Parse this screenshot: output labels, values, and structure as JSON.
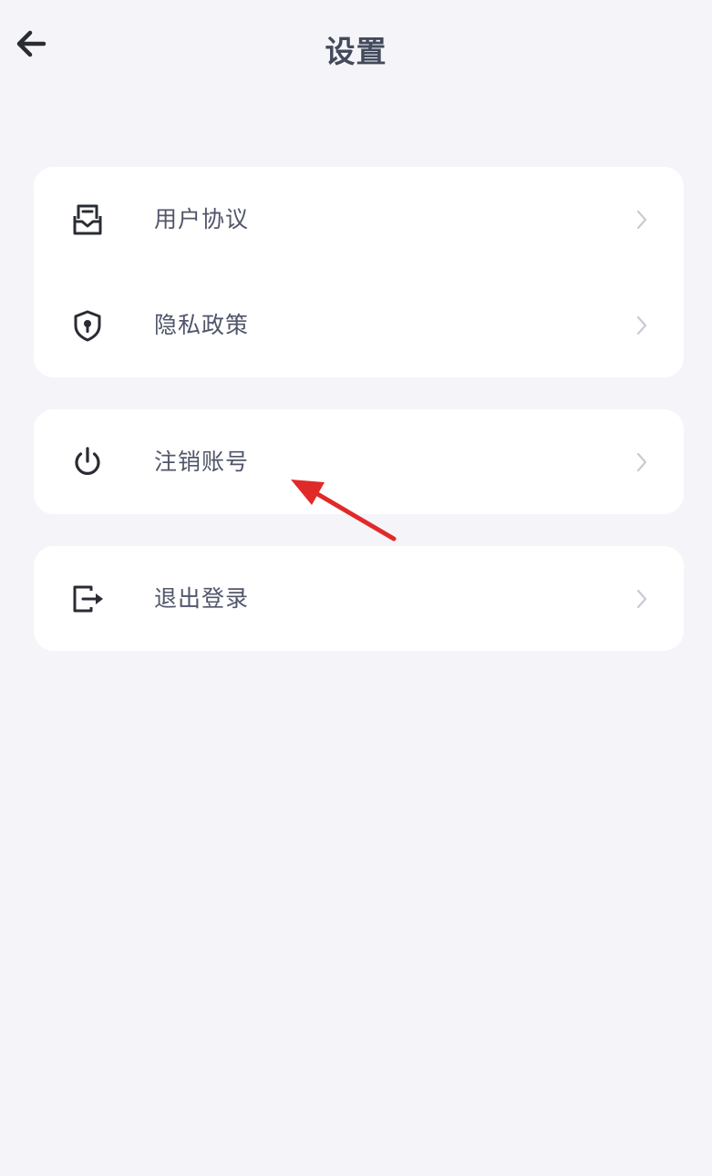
{
  "header": {
    "title": "设置",
    "back_icon": "arrow-left-icon"
  },
  "menu": {
    "groups": [
      {
        "items": [
          {
            "label": "用户协议",
            "icon": "document-tray-icon"
          },
          {
            "label": "隐私政策",
            "icon": "shield-lock-icon"
          }
        ]
      },
      {
        "items": [
          {
            "label": "注销账号",
            "icon": "power-icon"
          }
        ]
      },
      {
        "items": [
          {
            "label": "退出登录",
            "icon": "logout-icon"
          }
        ]
      }
    ],
    "chevron_icon": "chevron-right-icon"
  },
  "annotation": {
    "arrow_color": "#e02a2a"
  },
  "colors": {
    "background": "#f5f5f9",
    "card": "#ffffff",
    "title": "#434a5c",
    "label": "#51566a",
    "icon": "#2a2c33",
    "chevron": "#c9cbd2"
  }
}
